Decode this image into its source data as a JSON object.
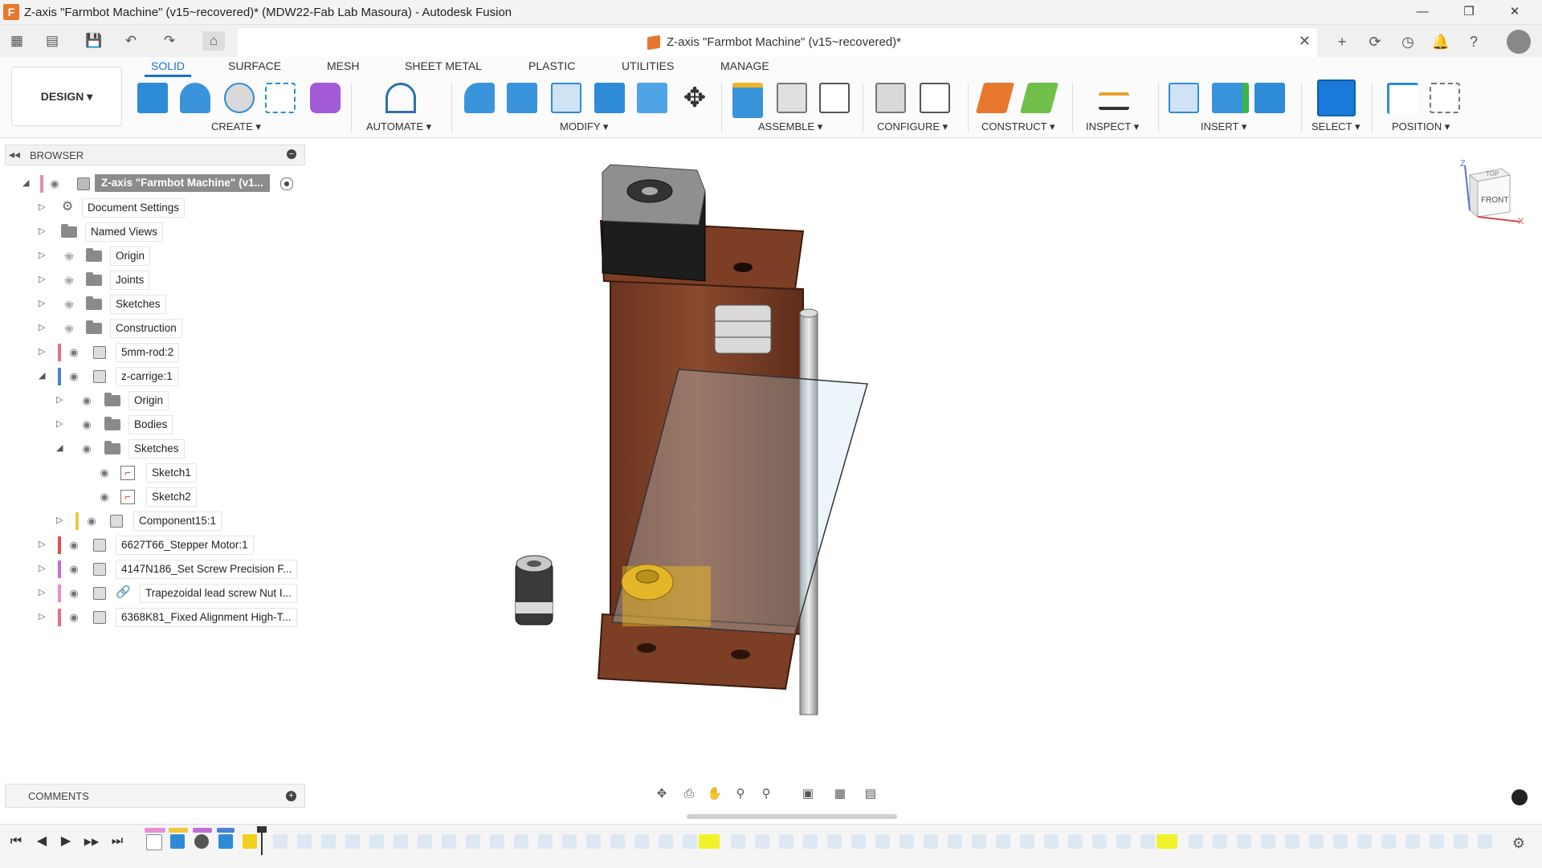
{
  "window": {
    "title": "Z-axis \"Farmbot Machine\" (v15~recovered)* (MDW22-Fab Lab Masoura) - Autodesk Fusion",
    "logo_letter": "F",
    "controls": [
      "—",
      "❐",
      "✕"
    ]
  },
  "quick_access": {
    "grid_icon": "▦",
    "file_icon": "▤",
    "save_icon": "💾",
    "undo_icon": "↶",
    "redo_icon": "↷",
    "home_icon": "⌂"
  },
  "document_tab": {
    "title": "Z-axis \"Farmbot Machine\" (v15~recovered)*",
    "close": "✕"
  },
  "right_icons": [
    "+",
    "⟳",
    "◷",
    "🔔",
    "?",
    "●"
  ],
  "workspace": {
    "label": "DESIGN ▾"
  },
  "ribbon_tabs": [
    "SOLID",
    "SURFACE",
    "MESH",
    "SHEET METAL",
    "PLASTIC",
    "UTILITIES",
    "MANAGE"
  ],
  "ribbon_groups": [
    "CREATE ▾",
    "AUTOMATE ▾",
    "MODIFY ▾",
    "ASSEMBLE ▾",
    "CONFIGURE ▾",
    "CONSTRUCT ▾",
    "INSPECT ▾",
    "INSERT ▾",
    "SELECT ▾",
    "POSITION ▾"
  ],
  "browser": {
    "label": "BROWSER",
    "collapse_icon": "◂◂",
    "minus": "−",
    "eye_glyph": "◉",
    "root_label": "Z-axis \"Farmbot Machine\" (v1...",
    "items": [
      {
        "label": "Document Settings"
      },
      {
        "label": "Named Views"
      },
      {
        "label": "Origin"
      },
      {
        "label": "Joints"
      },
      {
        "label": "Sketches"
      },
      {
        "label": "Construction"
      },
      {
        "label": "5mm-rod:2"
      },
      {
        "label": "z-carrige:1"
      },
      {
        "label": "Origin"
      },
      {
        "label": "Bodies"
      },
      {
        "label": "Sketches"
      },
      {
        "label": "Sketch1"
      },
      {
        "label": "Sketch2"
      },
      {
        "label": "Component15:1"
      },
      {
        "label": "6627T66_Stepper Motor:1"
      },
      {
        "label": "4147N186_Set Screw Precision F..."
      },
      {
        "label": "Trapezoidal lead screw Nut I..."
      },
      {
        "label": "6368K81_Fixed Alignment High-T..."
      }
    ]
  },
  "comments": {
    "label": "COMMENTS",
    "plus": "+"
  },
  "viewcube": {
    "top": "TOP",
    "front": "FRONT",
    "axis_z": "Z",
    "axis_x": "X"
  },
  "navbar_icons": [
    "✥",
    "⎙",
    "✋",
    "⚲",
    "⚲",
    "▣",
    "▦",
    "▤"
  ],
  "timeline": {
    "controls": [
      "⏮",
      "◀",
      "▶",
      "▶▶",
      "⏭"
    ],
    "settings_icon": "⚙"
  },
  "colors": {
    "accent": "#1a6fd1",
    "wood": "#7a3f23",
    "highlight": "#f2d21a",
    "fusion_orange": "#e8772e"
  }
}
